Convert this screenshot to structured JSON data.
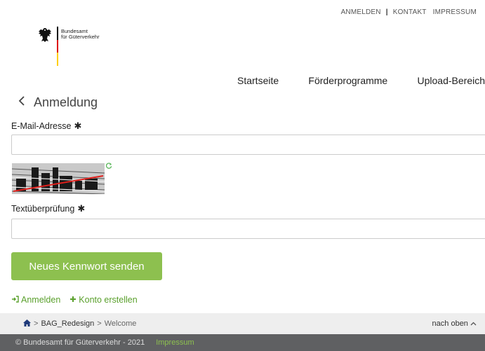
{
  "top_links": {
    "login": "ANMELDEN",
    "separator": "|",
    "contact": "KONTAKT",
    "imprint": "IMPRESSUM"
  },
  "logo": {
    "line1": "Bundesamt",
    "line2": "für Güterverkehr"
  },
  "main_nav": {
    "home": "Startseite",
    "funding": "Förderprogramme",
    "upload": "Upload-Bereich"
  },
  "page": {
    "back_icon": "chevron-left-icon",
    "title": "Anmeldung"
  },
  "form": {
    "email_label": "E-Mail-Adresse",
    "email_value": "",
    "required_marker": "✱",
    "captcha_icon": "captcha-image",
    "refresh_icon": "refresh-icon",
    "captcha_label": "Textüberprüfung",
    "captcha_value": "",
    "submit_label": "Neues Kennwort senden"
  },
  "links": {
    "login": "Anmelden",
    "login_icon": "sign-in-icon",
    "create": "Konto erstellen",
    "create_icon": "plus-icon"
  },
  "breadcrumb": {
    "home_icon": "home-icon",
    "item1": "BAG_Redesign",
    "item2": "Welcome",
    "to_top": "nach oben",
    "to_top_icon": "chevron-up-icon"
  },
  "footer": {
    "copyright": "© Bundesamt für Güterverkehr - 2021",
    "imprint": "Impressum"
  },
  "colors": {
    "accent_green": "#8dc04f",
    "link_green": "#5aa02c",
    "footer_bg": "#5f6062",
    "breadcrumb_bg": "#eeeeee"
  }
}
